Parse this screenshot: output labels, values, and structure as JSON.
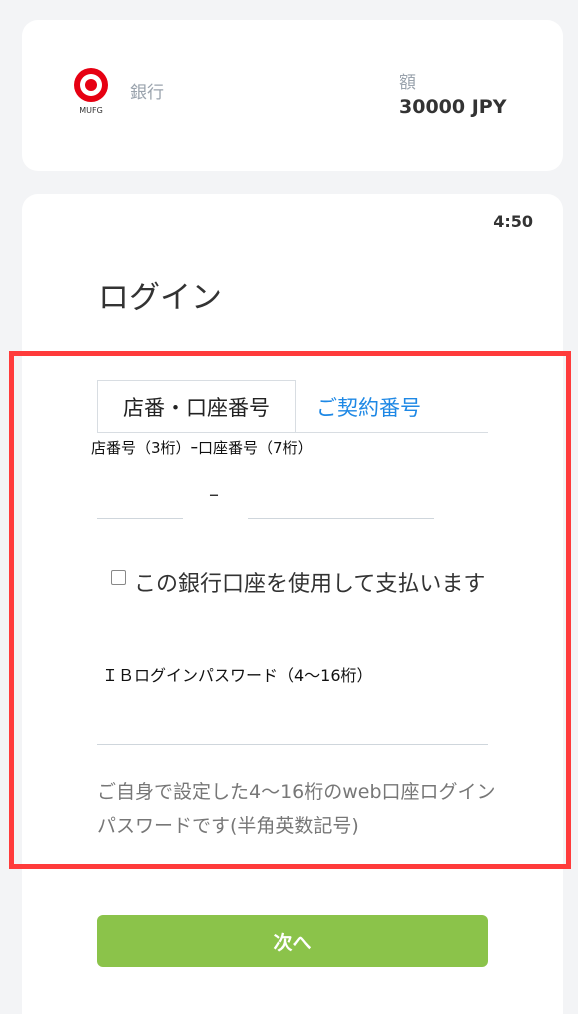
{
  "payment_summary": {
    "bank_logo": "MUFG",
    "bank_label": "銀行",
    "amount_label": "額",
    "amount_value": "30000 JPY"
  },
  "login": {
    "timer": "4:50",
    "title": "ログイン",
    "tabs": [
      {
        "label": "店番・口座番号",
        "active": true
      },
      {
        "label": "ご契約番号",
        "active": false
      }
    ],
    "account_label": "店番号（3桁）ｰ口座番号（7桁）",
    "dash": "–",
    "branch_number_value": "",
    "account_number_value": "",
    "checkbox_label": "この銀行口座を使用して支払います",
    "checkbox_checked": false,
    "password_label": "ＩＢログインパスワード（4～16桁）",
    "password_value": "",
    "help_text": "ご自身で設定した4～16桁のweb口座ログインパスワードです(半角英数記号)",
    "next_button": "次へ"
  },
  "colors": {
    "accent_green": "#8bc34a",
    "tab_link_blue": "#1e88e5",
    "highlight_red": "#ff3b3b",
    "logo_red": "#e60012"
  }
}
